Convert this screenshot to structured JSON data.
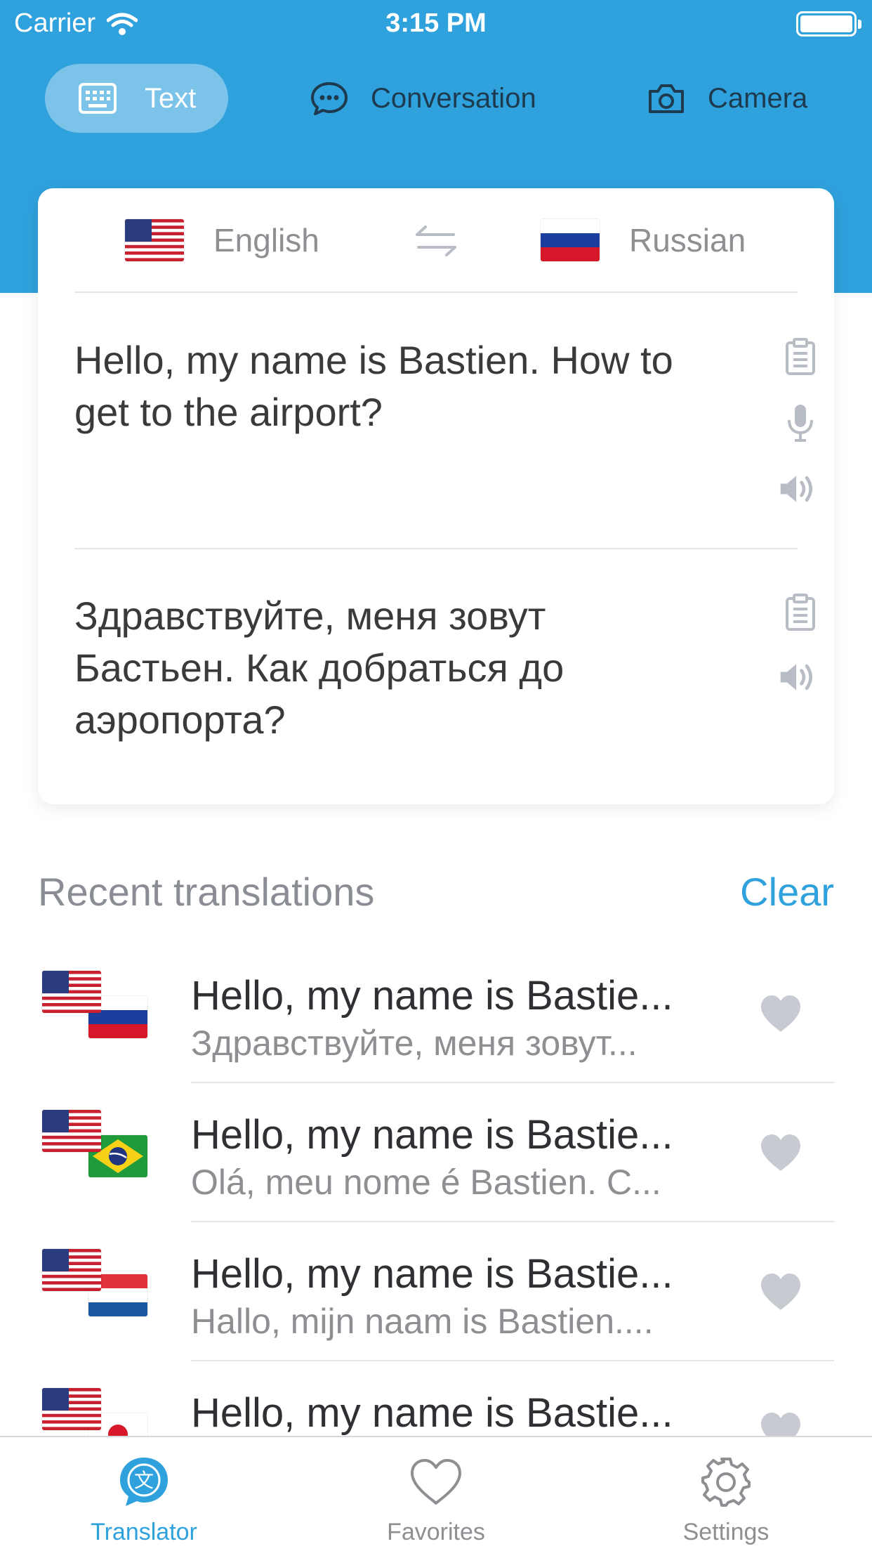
{
  "status_bar": {
    "carrier": "Carrier",
    "time": "3:15 PM"
  },
  "modes": [
    {
      "label": "Text",
      "icon": "keyboard-icon",
      "active": true
    },
    {
      "label": "Conversation",
      "icon": "chat-bubble-icon",
      "active": false
    },
    {
      "label": "Camera",
      "icon": "camera-icon",
      "active": false
    }
  ],
  "translator": {
    "source_lang": "English",
    "target_lang": "Russian",
    "source_text": "Hello, my name is Bastien. How to get to the airport?",
    "target_text": "Здравствуйте, меня зовут Бастьен. Как добраться до аэропорта?"
  },
  "recent": {
    "title": "Recent translations",
    "clear_label": "Clear",
    "items": [
      {
        "source": "Hello, my name is Bastie...",
        "target": "Здравствуйте, меня зовут...",
        "from_flag": "us-flag",
        "to_flag": "ru-flag"
      },
      {
        "source": "Hello, my name is Bastie...",
        "target": "Olá, meu nome é Bastien. C...",
        "from_flag": "us-flag",
        "to_flag": "br-flag"
      },
      {
        "source": "Hello, my name is Bastie...",
        "target": "Hallo, mijn naam is Bastien....",
        "from_flag": "us-flag",
        "to_flag": "nl-flag"
      },
      {
        "source": "Hello, my name is Bastie...",
        "target": "",
        "from_flag": "us-flag",
        "to_flag": "jp-flag"
      }
    ]
  },
  "tabbar": {
    "items": [
      {
        "label": "Translator",
        "icon": "translate-icon",
        "active": true
      },
      {
        "label": "Favorites",
        "icon": "heart-icon",
        "active": false
      },
      {
        "label": "Settings",
        "icon": "gear-icon",
        "active": false
      }
    ]
  },
  "colors": {
    "accent": "#2fa1dc",
    "active_tab_pill": "#7cc3ea",
    "muted": "#8e8e93",
    "heart": "#c7cad1"
  }
}
